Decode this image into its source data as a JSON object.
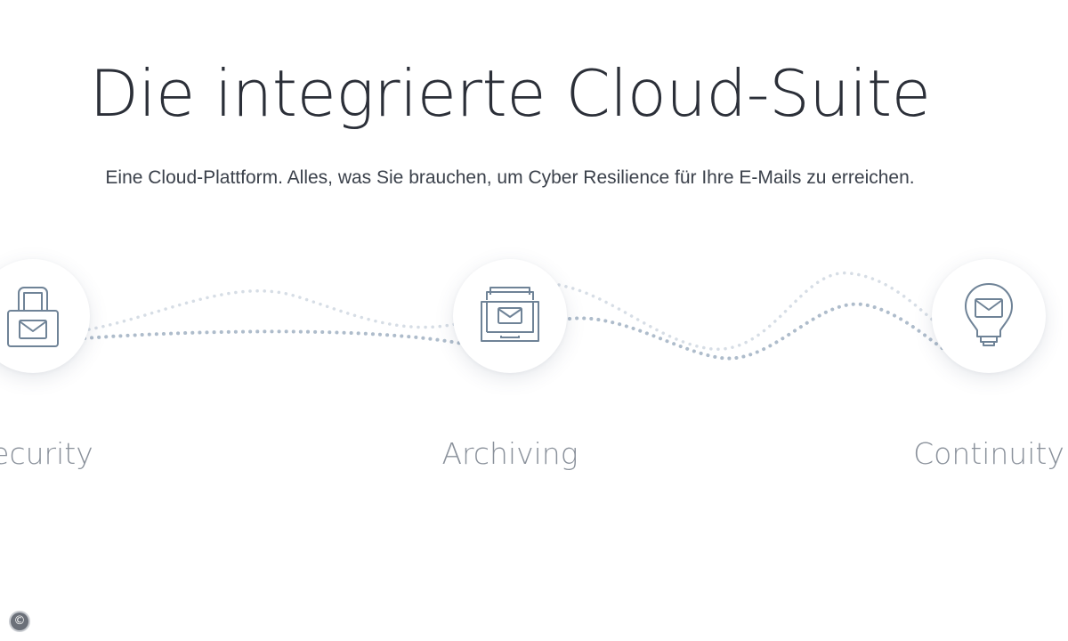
{
  "hero": {
    "title": "Die integrierte Cloud-Suite",
    "subtitle": "Eine Cloud-Plattform. Alles, was Sie brauchen, um Cyber Resilience für Ihre E-Mails zu erreichen."
  },
  "products": [
    {
      "label": "Security",
      "icon": "lock-mail-icon"
    },
    {
      "label": "Archiving",
      "icon": "archive-tray-mail-icon"
    },
    {
      "label": "Continuity",
      "icon": "lightbulb-mail-icon"
    }
  ],
  "footer": {
    "copyright_symbol": "©"
  },
  "colors": {
    "title": "#2b2f38",
    "subtitle": "#3b414b",
    "label": "#8a919b",
    "icon_stroke": "#6f8397",
    "wave_dot": "#aebccb",
    "badge_bg": "#ffffff"
  }
}
